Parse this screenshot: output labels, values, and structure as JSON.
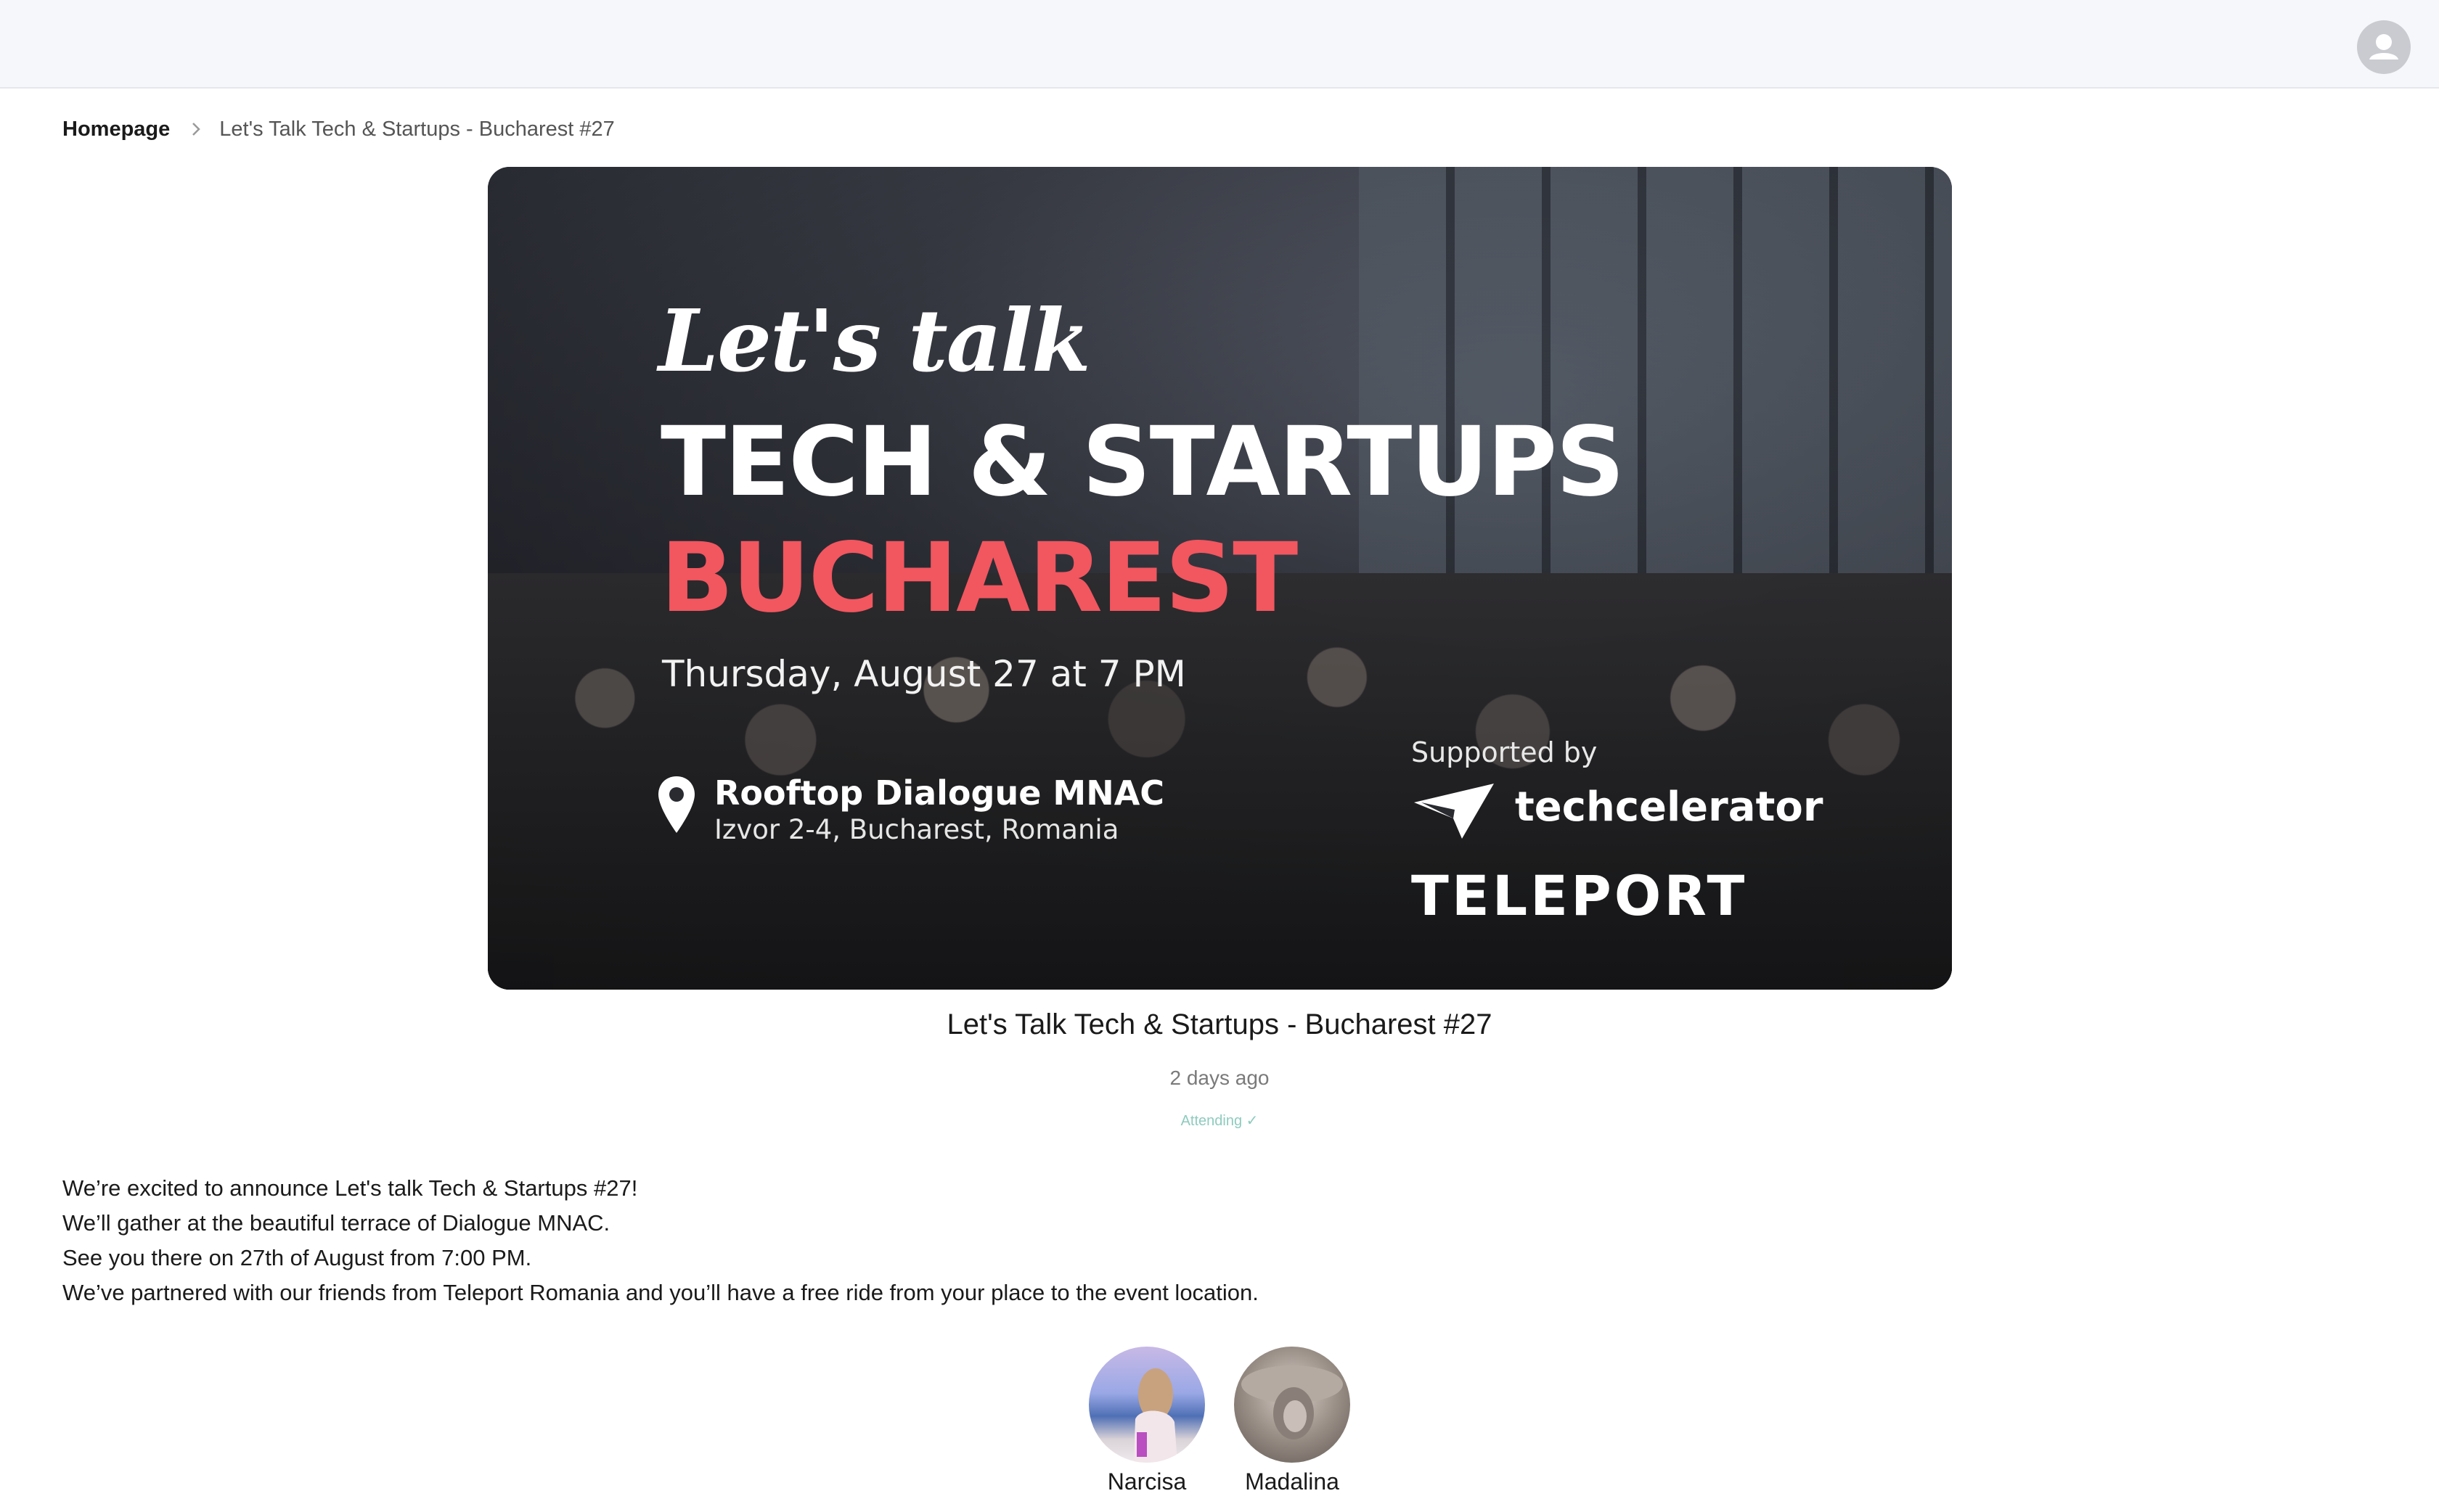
{
  "breadcrumb": {
    "home": "Homepage",
    "current": "Let's Talk Tech & Startups - Bucharest #27"
  },
  "banner": {
    "script": "Let's talk",
    "headline": "TECH & STARTUPS",
    "city": "BUCHAREST",
    "date": "Thursday, August 27 at 7 PM",
    "venue": "Rooftop Dialogue MNAC",
    "address": "Izvor 2-4, Bucharest, Romania",
    "supported_by": "Supported by",
    "sponsor1": "techcelerator",
    "sponsor2": "TELEPORT",
    "accent_color": "#f2565f"
  },
  "event": {
    "title": "Let's Talk Tech & Startups - Bucharest #27",
    "posted": "2 days ago",
    "status": "Attending ✓",
    "description": [
      "We’re excited to announce Let's talk Tech & Startups #27!",
      "We’ll gather at the beautiful terrace of Dialogue MNAC.",
      "See you there on 27th of August from 7:00 PM.",
      "We’ve partnered with our friends from Teleport Romania and you’ll have a free ride from your place to the event location."
    ]
  },
  "attendees": [
    {
      "name": "Narcisa"
    },
    {
      "name": "Madalina"
    }
  ],
  "colors": {
    "topbar": "#f6f7fb",
    "attending": "#8ecbbd"
  }
}
